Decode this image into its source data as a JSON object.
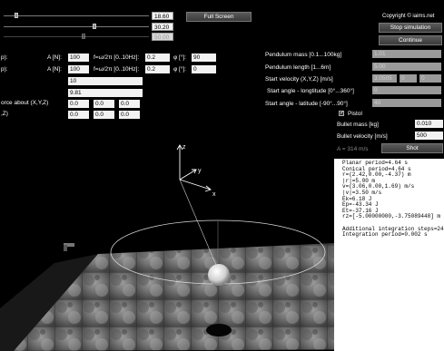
{
  "top_sliders": [
    {
      "value": "18.60"
    },
    {
      "value": "30.20"
    },
    {
      "value": "50.00"
    }
  ],
  "full_screen_label": "Full Screen",
  "copyright": "Copyright © iaims.net",
  "stop_label": "Stop simulation",
  "continue_label": "Continue",
  "force_rows": [
    {
      "prefix": "p):",
      "a_label": "A [N]:",
      "a_value": "100",
      "f_label": "f=ω/2π [0..10Hz]:",
      "f_value": "0.2",
      "phi_label": "φ [°]:",
      "phi_value": "90"
    },
    {
      "prefix": "p):",
      "a_label": "A [N]:",
      "a_value": "100",
      "f_label": "f=ω/2π [0..10Hz]:",
      "f_value": "0.2",
      "phi_label": "φ [°]:",
      "phi_value": "0"
    }
  ],
  "extra_values": [
    "10",
    "9.81"
  ],
  "torque_label": "orce about (X,Y,Z)",
  "torque_values": [
    "0.0",
    "0.0",
    "0.0"
  ],
  "z_label": ",Z)",
  "z_values": [
    "0.0",
    "0.0",
    "0.0"
  ],
  "right_panel": {
    "mass_label": "Pendulum mass [0.1...100kg]",
    "mass_value": "1.01",
    "length_label": "Pendulum length [1...6m]",
    "length_value": "5.00",
    "velocity_label": "Start velocity (X,Y,Z) [m/s]",
    "velocity_values": [
      "3.0505",
      "0",
      "0"
    ],
    "longitude_label": "Start angle - longtitude [0°...360°]",
    "longitude_value": "0",
    "latitude_label": "Start angle - latitude [-90°...90°]",
    "latitude_value": "40",
    "pistol_label": "Pistol",
    "pistol_checked": "✓",
    "bullet_mass_label": "Bullet mass [kg]",
    "bullet_mass_value": "0.010",
    "bullet_velocity_label": "Bullet velocity [m/s]",
    "bullet_velocity_value": "500",
    "aim_label": "A = 314 m/s",
    "shot_label": "Shot"
  },
  "info_lines": [
    "Planar period=4.64 s",
    "Conical period=4.64 s",
    "r=(2.42,0.00,-4.37) m",
    "|r|=5.00 m",
    "v=(3.06,0.00,1.69) m/s",
    "|v|=3.50 m/s",
    "Ek=6.18 J",
    "Ep=-43.34 J",
    "Et=-37.16 J",
    "rz=[-5.00000000,-3.75089448] m",
    "",
    "Additional integration steps=24",
    "Integration period=0.002 s"
  ],
  "axes": {
    "x": "x",
    "y": "y",
    "z": "z"
  }
}
